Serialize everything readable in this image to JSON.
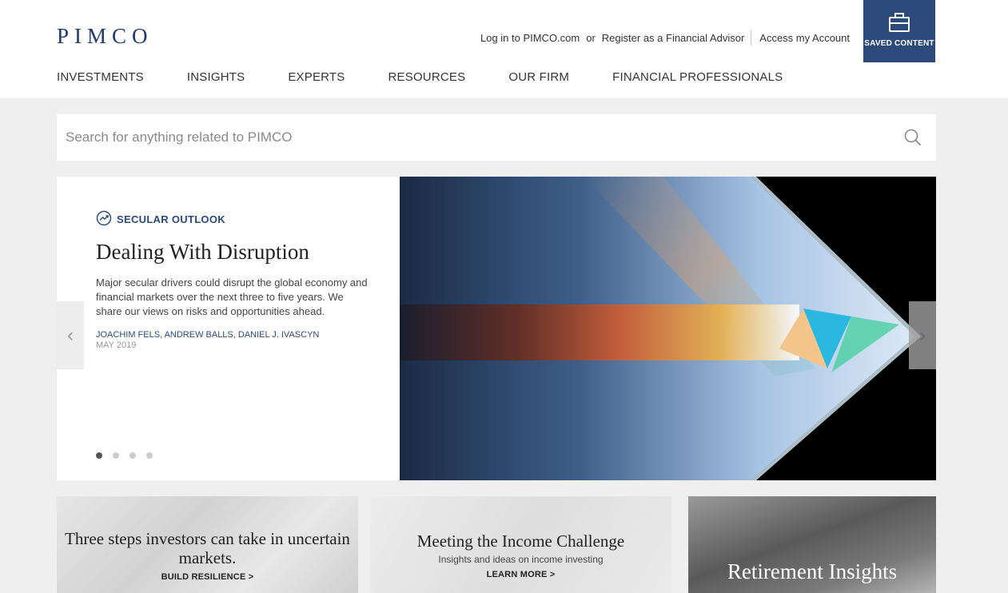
{
  "header": {
    "logo": "PIMCO",
    "login_label": "Log in to PIMCO.com",
    "or_label": "or",
    "register_label": "Register as a Financial Advisor",
    "account_label": "Access my Account",
    "saved_label": "SAVED CONTENT"
  },
  "nav": {
    "items": [
      {
        "label": "INVESTMENTS"
      },
      {
        "label": "INSIGHTS"
      },
      {
        "label": "EXPERTS"
      },
      {
        "label": "RESOURCES"
      },
      {
        "label": "OUR FIRM"
      },
      {
        "label": "FINANCIAL PROFESSIONALS"
      }
    ]
  },
  "search": {
    "placeholder": "Search for anything related to PIMCO"
  },
  "hero": {
    "eyebrow": "SECULAR OUTLOOK",
    "title": "Dealing With Disruption",
    "description": "Major secular drivers could disrupt the global economy and financial markets over the next three to five years. We share our views on risks and opportunities ahead.",
    "authors": "JOACHIM FELS, ANDREW BALLS, DANIEL J. IVASCYN",
    "date": "MAY 2019",
    "slide_count": 4,
    "active_slide": 1,
    "prev_arrow": "‹",
    "next_arrow": "›"
  },
  "cards": [
    {
      "title": "Three steps investors can take in uncertain markets.",
      "link": "BUILD RESILIENCE >"
    },
    {
      "title": "Meeting the Income Challenge",
      "subtitle": "Insights and ideas on income investing",
      "link": "LEARN MORE >"
    },
    {
      "title": "Retirement Insights"
    }
  ],
  "colors": {
    "brand": "#1f3a6e",
    "accent": "#2c4a7a",
    "page_bg": "#efefef"
  }
}
